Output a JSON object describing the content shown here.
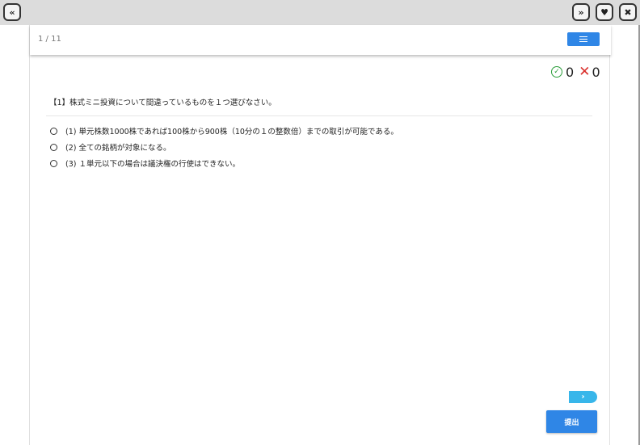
{
  "toolbar": {
    "collapse_icon": "double-chevron-up",
    "forward_icon": "double-chevron-right",
    "favorite_icon": "heart",
    "close_icon": "x"
  },
  "header": {
    "counter": "1 / 11",
    "menu_icon": "hamburger-menu"
  },
  "score": {
    "correct_count": "0",
    "wrong_count": "0",
    "correct_color": "#2a9d3a",
    "wrong_color": "#d9302c"
  },
  "question": {
    "text": "【1】株式ミニ投資について間違っているものを１つ選びなさい。",
    "options": [
      "(1) 単元株数1000株であれば100株から900株（10分の１の整数倍）までの取引が可能である。",
      "(2) 全ての銘柄が対象になる。",
      "(3) １単元以下の場合は議決権の行使はできない。"
    ]
  },
  "actions": {
    "next_label": "›",
    "submit_label": "提出",
    "accent_color": "#2f86e6"
  }
}
